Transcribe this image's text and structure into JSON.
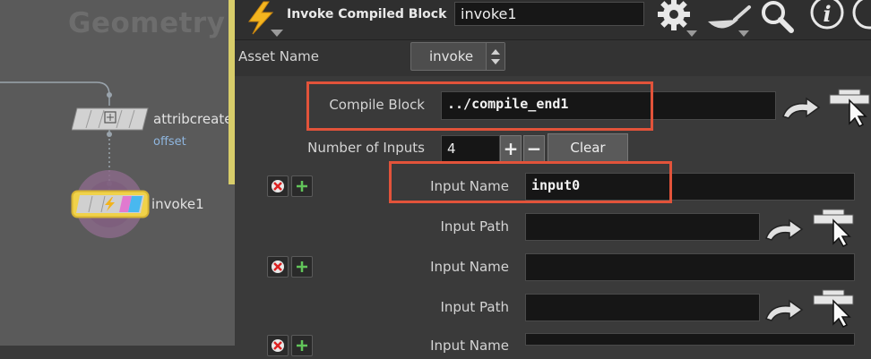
{
  "network": {
    "title": "Geometry",
    "nodes": [
      {
        "name": "attribcreate",
        "subtitle": "offset"
      },
      {
        "name": "invoke1"
      }
    ]
  },
  "header": {
    "type_label": "Invoke Compiled Block",
    "node_name": "invoke1",
    "icons": [
      "lightning-icon",
      "gear-icon",
      "wok-icon",
      "magnifier-icon",
      "info-icon"
    ]
  },
  "params": {
    "asset_name_label": "Asset Name",
    "asset_name_value": "invoke",
    "compile_block_label": "Compile Block",
    "compile_block_value": "../compile_end1",
    "num_inputs_label": "Number of Inputs",
    "num_inputs_value": "4",
    "plus_label": "+",
    "minus_label": "−",
    "clear_label": "Clear",
    "inputs": [
      {
        "name_label": "Input Name",
        "name_value": "input0",
        "path_label": "Input Path",
        "path_value": ""
      },
      {
        "name_label": "Input Name",
        "name_value": "",
        "path_label": "Input Path",
        "path_value": ""
      },
      {
        "name_label": "Input Name",
        "name_value": ""
      }
    ]
  },
  "colors": {
    "highlight": "#e2533a",
    "node_selected": "#f0d24a",
    "divider": "#d8cd6a",
    "subtitle": "#8fb6df"
  }
}
